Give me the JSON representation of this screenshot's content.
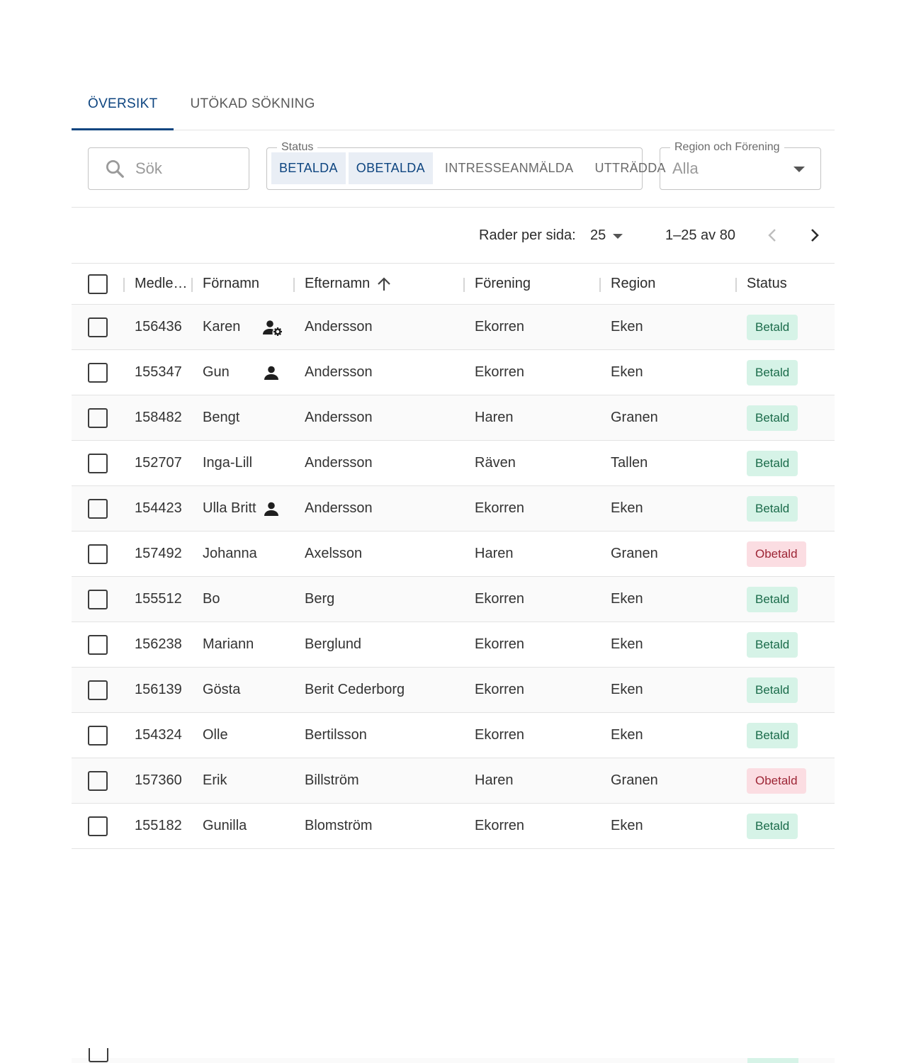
{
  "tabs": [
    {
      "label": "ÖVERSIKT",
      "active": true
    },
    {
      "label": "UTÖKAD SÖKNING",
      "active": false
    }
  ],
  "search": {
    "placeholder": "Sök",
    "icon": "search-icon"
  },
  "status_filter": {
    "legend": "Status",
    "options": [
      {
        "label": "BETALDA",
        "selected": true
      },
      {
        "label": "OBETALDA",
        "selected": true
      },
      {
        "label": "INTRESSEANMÄLDA",
        "selected": false
      },
      {
        "label": "UTTRÄDDA",
        "selected": false
      }
    ]
  },
  "region_filter": {
    "legend": "Region och Förening",
    "value": "Alla"
  },
  "pagination": {
    "rows_per_page_label": "Rader per sida:",
    "rows_per_page": "25",
    "range": "1–25 av 80"
  },
  "columns": {
    "id": "Medle…",
    "first": "Förnamn",
    "last": "Efternamn",
    "forening": "Förening",
    "region": "Region",
    "status": "Status"
  },
  "rows": [
    {
      "id": "156436",
      "first": "Karen",
      "icon": "user-gear-icon",
      "last": "Andersson",
      "forening": "Ekorren",
      "region": "Eken",
      "status": "Betald",
      "paid": true
    },
    {
      "id": "155347",
      "first": "Gun",
      "icon": "user-icon",
      "last": "Andersson",
      "forening": "Ekorren",
      "region": "Eken",
      "status": "Betald",
      "paid": true
    },
    {
      "id": "158482",
      "first": "Bengt",
      "icon": "",
      "last": "Andersson",
      "forening": "Haren",
      "region": "Granen",
      "status": "Betald",
      "paid": true
    },
    {
      "id": "152707",
      "first": "Inga-Lill",
      "icon": "",
      "last": "Andersson",
      "forening": "Räven",
      "region": "Tallen",
      "status": "Betald",
      "paid": true
    },
    {
      "id": "154423",
      "first": "Ulla Britt",
      "icon": "user-icon",
      "last": "Andersson",
      "forening": "Ekorren",
      "region": "Eken",
      "status": "Betald",
      "paid": true
    },
    {
      "id": "157492",
      "first": "Johanna",
      "icon": "",
      "last": "Axelsson",
      "forening": "Haren",
      "region": "Granen",
      "status": "Obetald",
      "paid": false
    },
    {
      "id": "155512",
      "first": "Bo",
      "icon": "",
      "last": "Berg",
      "forening": "Ekorren",
      "region": "Eken",
      "status": "Betald",
      "paid": true
    },
    {
      "id": "156238",
      "first": "Mariann",
      "icon": "",
      "last": "Berglund",
      "forening": "Ekorren",
      "region": "Eken",
      "status": "Betald",
      "paid": true
    },
    {
      "id": "156139",
      "first": "Gösta",
      "icon": "",
      "last": "Berit Cederborg",
      "forening": "Ekorren",
      "region": "Eken",
      "status": "Betald",
      "paid": true
    },
    {
      "id": "154324",
      "first": "Olle",
      "icon": "",
      "last": "Bertilsson",
      "forening": "Ekorren",
      "region": "Eken",
      "status": "Betald",
      "paid": true
    },
    {
      "id": "157360",
      "first": "Erik",
      "icon": "",
      "last": "Billström",
      "forening": "Haren",
      "region": "Granen",
      "status": "Obetald",
      "paid": false
    },
    {
      "id": "155182",
      "first": "Gunilla",
      "icon": "",
      "last": "Blomström",
      "forening": "Ekorren",
      "region": "Eken",
      "status": "Betald",
      "paid": true
    }
  ]
}
